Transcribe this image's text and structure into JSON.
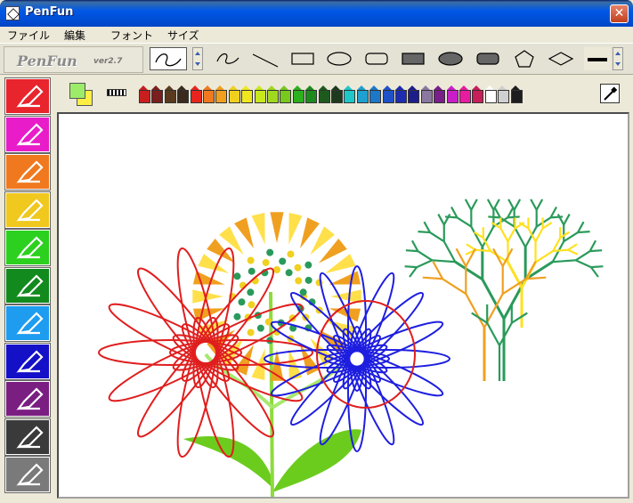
{
  "window": {
    "title": "PenFun",
    "close_label": "✕"
  },
  "menu": {
    "items": [
      "ファイル",
      "編集",
      "フォント",
      "サイズ"
    ]
  },
  "logo": {
    "name": "PenFun",
    "version": "ver2.7"
  },
  "shape_tools": [
    "freehand-icon",
    "line-icon",
    "rectangle-icon",
    "ellipse-icon",
    "rounded-rect-icon",
    "filled-rect-icon",
    "filled-ellipse-icon",
    "filled-rounded-rect-icon",
    "pentagon-icon",
    "diamond-icon"
  ],
  "pen_tools": [
    {
      "name": "pen-red-icon",
      "color": "#E8242C"
    },
    {
      "name": "pen-flower-icon",
      "color": "#E81CC8"
    },
    {
      "name": "pen-spiral-icon",
      "color": "#F0781E"
    },
    {
      "name": "pen-rainbow-icon",
      "color": "#F0C81E"
    },
    {
      "name": "pen-sparkle-icon",
      "color": "#2CD01E"
    },
    {
      "name": "pen-text-icon",
      "color": "#128A1E"
    },
    {
      "name": "pen-random-icon",
      "color": "#1E9CF0"
    },
    {
      "name": "spray-icon",
      "color": "#1410C8"
    },
    {
      "name": "fill-bucket-icon",
      "color": "#7A1E82"
    },
    {
      "name": "eraser-icon",
      "color": "#3A3A3A"
    },
    {
      "name": "undo-icon",
      "color": "#7A7A7A"
    }
  ],
  "colors": {
    "foreground": "#9CEC6A",
    "background": "#FFEE44",
    "palette": [
      "#C81E1E",
      "#7A1E1E",
      "#5A3A1E",
      "#3A2A1E",
      "#E8241E",
      "#F0781E",
      "#F0A01E",
      "#F0D01E",
      "#F0E81E",
      "#C8E81E",
      "#A0D81E",
      "#78C81E",
      "#2CB01E",
      "#1E8A1E",
      "#1E5A1E",
      "#1E3A1E",
      "#1EC8C8",
      "#1EA0D0",
      "#1E78C8",
      "#1E50C8",
      "#1E2CB0",
      "#1E1E8A",
      "#8A78A0",
      "#7A1E8A",
      "#C81EC8",
      "#E81CA0",
      "#C81E5A",
      "#FFFFFF",
      "#D0D0D0",
      "#1E1E1E"
    ]
  }
}
